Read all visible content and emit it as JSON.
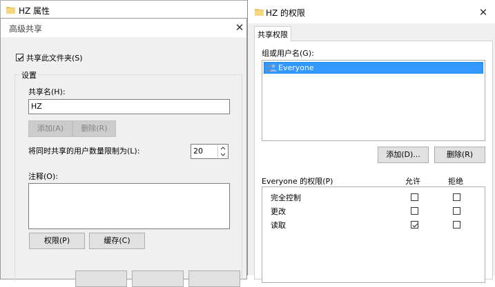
{
  "properties_window": {
    "title": "HZ 属性"
  },
  "advanced_dialog": {
    "title": "高级共享",
    "share_checkbox": {
      "label": "共享此文件夹(S)",
      "checked": true
    },
    "settings_label": "设置",
    "share_name_label": "共享名(H):",
    "share_name_value": "HZ",
    "add_button": "添加(A)",
    "remove_button": "删除(R)",
    "user_limit_label": "将同时共享的用户数量限制为(L):",
    "user_limit_value": "20",
    "comment_label": "注释(O):",
    "permissions_button": "权限(P)",
    "caching_button": "缓存(C)"
  },
  "permissions_window": {
    "title": "HZ 的权限",
    "tab_label": "共享权限",
    "group_label": "组或用户名(G):",
    "users": [
      {
        "name": "Everyone",
        "selected": true
      }
    ],
    "add_button": "添加(D)...",
    "remove_button": "删除(R)",
    "perm_header": "Everyone 的权限(P)",
    "allow_header": "允许",
    "deny_header": "拒绝",
    "permissions": [
      {
        "name": "完全控制",
        "allow": false,
        "deny": false
      },
      {
        "name": "更改",
        "allow": false,
        "deny": false
      },
      {
        "name": "读取",
        "allow": true,
        "deny": false
      }
    ]
  },
  "colors": {
    "selection": "#3399ff",
    "selection_border": "#0078d7",
    "dialog_bg": "#f0f0f0"
  }
}
